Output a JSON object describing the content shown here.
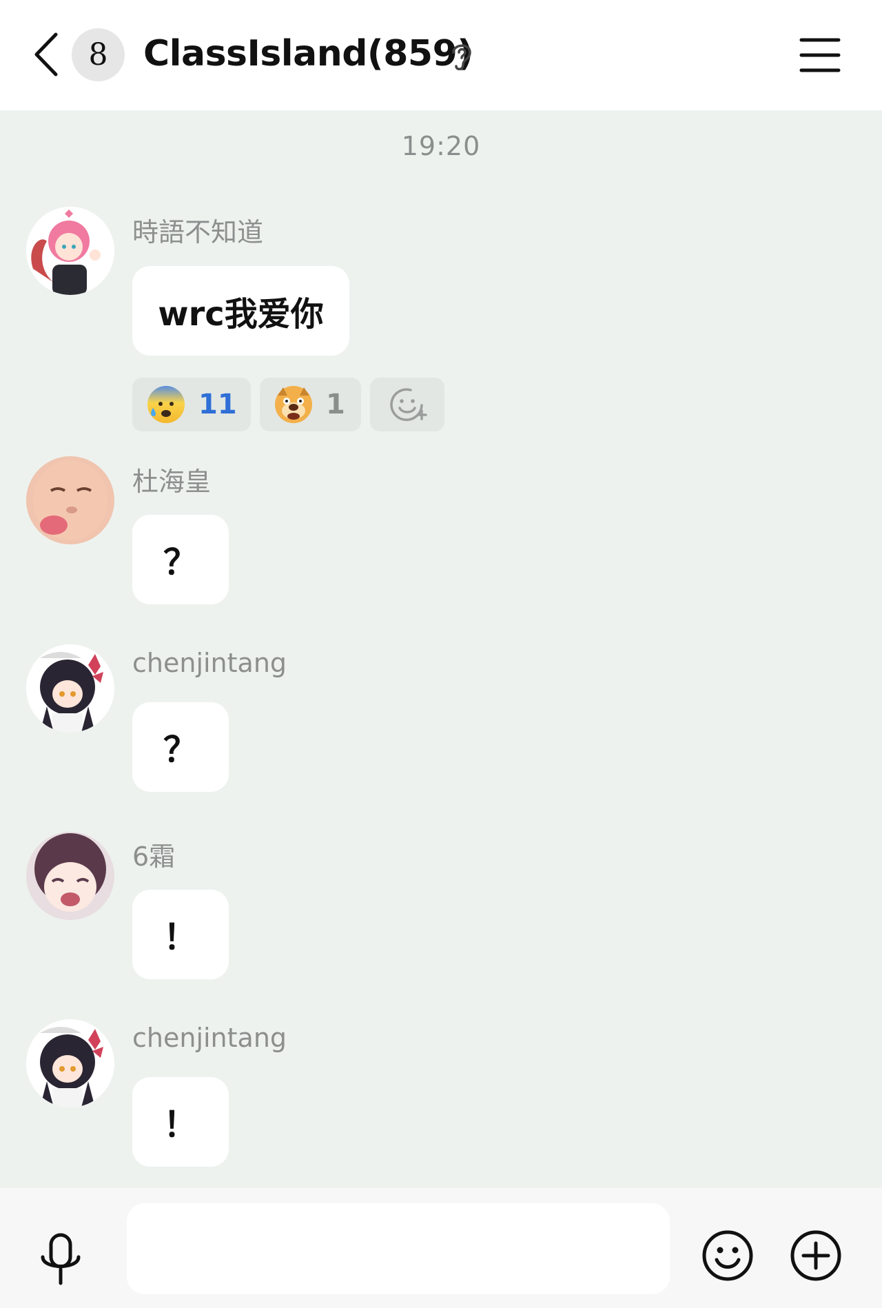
{
  "header": {
    "unread_count": "8",
    "title": "ClassIsland(859)"
  },
  "chat": {
    "timestamp": "19:20",
    "messages": [
      {
        "sender": "時語不知道",
        "text": "wrc我爱你"
      },
      {
        "sender": "杜海皇",
        "text": "？"
      },
      {
        "sender": "chenjintang",
        "text": "？"
      },
      {
        "sender": "6霜",
        "text": "！"
      },
      {
        "sender": "chenjintang",
        "text": "！"
      }
    ],
    "reactions": [
      {
        "icon": "anxious-sweat-emoji",
        "count": "11",
        "color": "#2f6fd6"
      },
      {
        "icon": "dog-face-emoji",
        "count": "1",
        "color": "#8a8e8c"
      },
      {
        "icon": "add-reaction-icon"
      }
    ]
  },
  "input": {
    "placeholder": ""
  },
  "colors": {
    "chat_background": "#edf2ef",
    "bubble": "#ffffff",
    "header": "#ffffff",
    "reaction_chip": "#e2e7e4",
    "reaction_active_count": "#2f6fd6"
  }
}
